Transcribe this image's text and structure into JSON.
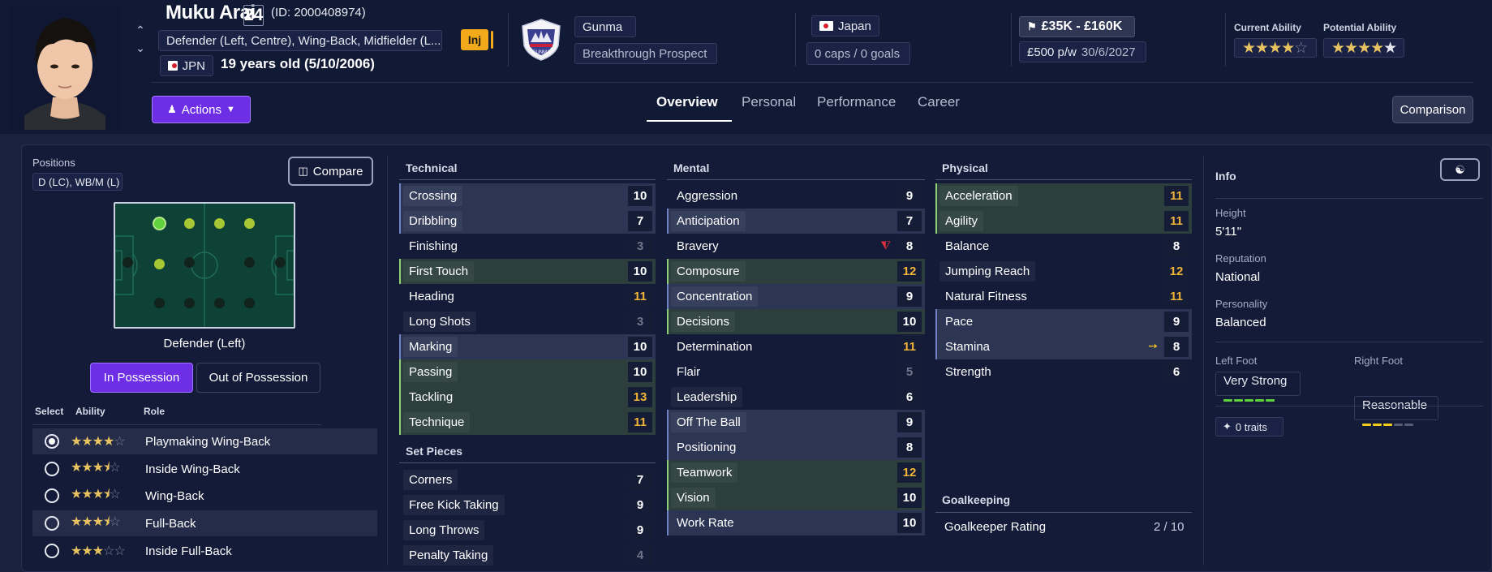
{
  "player": {
    "name": "Muku Arai",
    "number": "24",
    "id_text": "(ID: 2000408974)",
    "positions_text": "Defender (Left, Centre), Wing-Back, Midfielder (L...",
    "nationality_code": "JPN",
    "age_text": "19 years old (5/10/2006)",
    "injury_badge": "Inj"
  },
  "club": {
    "name": "Gunma",
    "status": "Breakthrough Prospect",
    "crest": "club-crest-icon"
  },
  "nation": {
    "name": "Japan",
    "caps": "0 caps / 0 goals"
  },
  "contract": {
    "value_range": "£35K - £160K",
    "wage": "£500 p/w",
    "expires": "30/6/2027"
  },
  "ability": {
    "current_label": "Current Ability",
    "current_stars": 4,
    "potential_label": "Potential Ability",
    "potential_stars": 5
  },
  "nav": {
    "actions_label": "Actions",
    "tabs": [
      "Overview",
      "Personal",
      "Performance",
      "Career"
    ],
    "active_tab": "Overview",
    "comparison_label": "Comparison"
  },
  "left_panel": {
    "positions_label": "Positions",
    "positions_value": "D (LC), WB/M (L)",
    "compare_label": "Compare",
    "selected_position": "Defender (Left)",
    "in_possession": "In Possession",
    "out_of_possession": "Out of Possession",
    "col_select": "Select",
    "col_ability": "Ability",
    "col_role": "Role",
    "roles": [
      {
        "name": "Playmaking Wing-Back",
        "stars": 4,
        "selected": true
      },
      {
        "name": "Inside Wing-Back",
        "stars": 3.5,
        "selected": false
      },
      {
        "name": "Wing-Back",
        "stars": 3.5,
        "selected": false
      },
      {
        "name": "Full-Back",
        "stars": 3.5,
        "selected": false
      },
      {
        "name": "Inside Full-Back",
        "stars": 3,
        "selected": false
      }
    ]
  },
  "technical": {
    "title": "Technical",
    "attrs": [
      {
        "name": "Crossing",
        "value": 10
      },
      {
        "name": "Dribbling",
        "value": 7
      },
      {
        "name": "Finishing",
        "value": 3
      },
      {
        "name": "First Touch",
        "value": 10
      },
      {
        "name": "Heading",
        "value": 11
      },
      {
        "name": "Long Shots",
        "value": 3
      },
      {
        "name": "Marking",
        "value": 10
      },
      {
        "name": "Passing",
        "value": 10
      },
      {
        "name": "Tackling",
        "value": 13
      },
      {
        "name": "Technique",
        "value": 11
      }
    ]
  },
  "set_pieces": {
    "title": "Set Pieces",
    "attrs": [
      {
        "name": "Corners",
        "value": 7
      },
      {
        "name": "Free Kick Taking",
        "value": 9
      },
      {
        "name": "Long Throws",
        "value": 9
      },
      {
        "name": "Penalty Taking",
        "value": 4
      }
    ]
  },
  "mental": {
    "title": "Mental",
    "attrs": [
      {
        "name": "Aggression",
        "value": 9
      },
      {
        "name": "Anticipation",
        "value": 7
      },
      {
        "name": "Bravery",
        "value": 8
      },
      {
        "name": "Composure",
        "value": 12
      },
      {
        "name": "Concentration",
        "value": 9
      },
      {
        "name": "Decisions",
        "value": 10
      },
      {
        "name": "Determination",
        "value": 11
      },
      {
        "name": "Flair",
        "value": 5
      },
      {
        "name": "Leadership",
        "value": 6
      },
      {
        "name": "Off The Ball",
        "value": 9
      },
      {
        "name": "Positioning",
        "value": 8
      },
      {
        "name": "Teamwork",
        "value": 12
      },
      {
        "name": "Vision",
        "value": 10
      },
      {
        "name": "Work Rate",
        "value": 10
      }
    ]
  },
  "physical": {
    "title": "Physical",
    "attrs": [
      {
        "name": "Acceleration",
        "value": 11
      },
      {
        "name": "Agility",
        "value": 11
      },
      {
        "name": "Balance",
        "value": 8
      },
      {
        "name": "Jumping Reach",
        "value": 12
      },
      {
        "name": "Natural Fitness",
        "value": 11
      },
      {
        "name": "Pace",
        "value": 9
      },
      {
        "name": "Stamina",
        "value": 8
      },
      {
        "name": "Strength",
        "value": 6
      }
    ]
  },
  "goalkeeping": {
    "title": "Goalkeeping",
    "rating_label": "Goalkeeper Rating",
    "rating_value": "2 / 10"
  },
  "info": {
    "title": "Info",
    "height_label": "Height",
    "height": "5'11\"",
    "reputation_label": "Reputation",
    "reputation": "National",
    "personality_label": "Personality",
    "personality": "Balanced",
    "left_foot_label": "Left Foot",
    "left_foot": "Very Strong",
    "left_foot_level": 5,
    "right_foot_label": "Right Foot",
    "right_foot": "Reasonable",
    "right_foot_level": 3,
    "traits": "0 traits"
  },
  "colors": {
    "accent": "#6d2ee6",
    "highlight_value": "#f0b437",
    "star": "#e8c261"
  }
}
